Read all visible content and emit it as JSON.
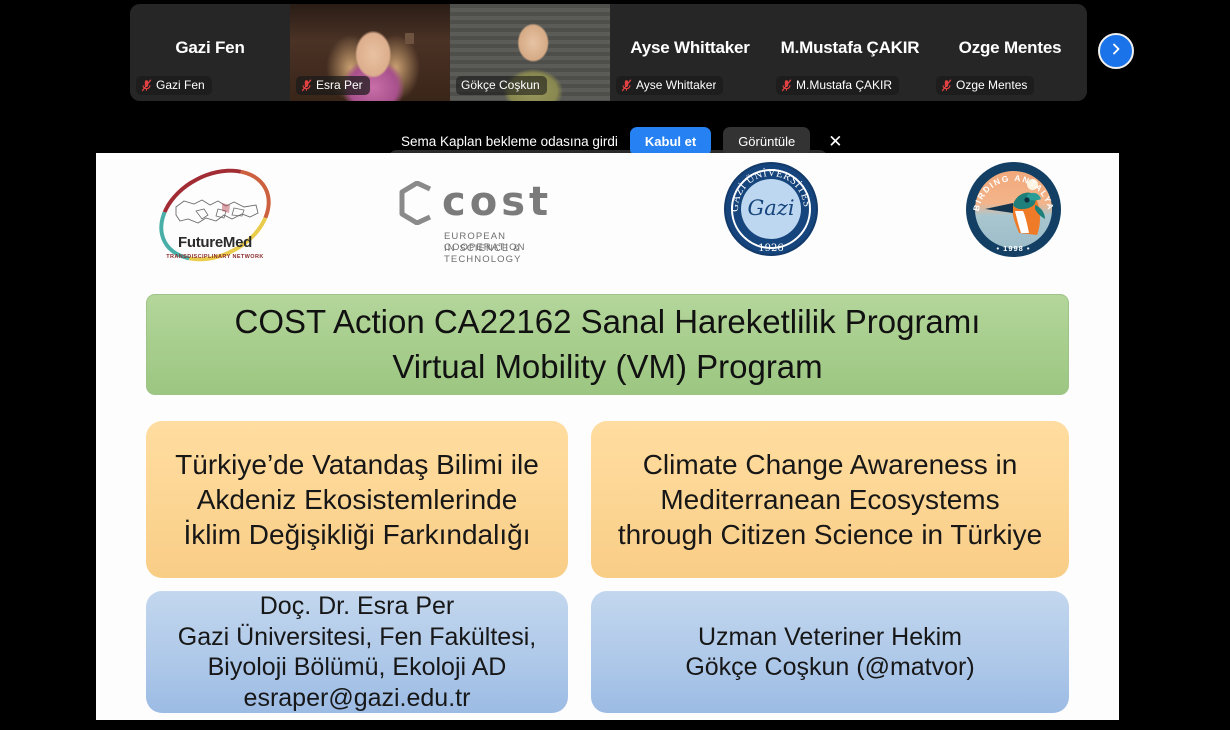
{
  "meeting": {
    "filmstrip": {
      "tiles": [
        {
          "display_name": "Gazi Fen",
          "badge_label": "Gazi Fen",
          "muted": true,
          "has_video": false,
          "active_speaker": false
        },
        {
          "display_name": "Esra Per",
          "badge_label": "Esra Per",
          "muted": true,
          "has_video": true,
          "active_speaker": false
        },
        {
          "display_name": "Gökçe Coşkun",
          "badge_label": "Gökçe Coşkun",
          "muted": false,
          "has_video": true,
          "active_speaker": true
        },
        {
          "display_name": "Ayse Whittaker",
          "badge_label": "Ayse Whittaker",
          "muted": true,
          "has_video": false,
          "active_speaker": false
        },
        {
          "display_name": "M.Mustafa ÇAKIR",
          "badge_label": "M.Mustafa ÇAKIR",
          "muted": true,
          "has_video": false,
          "active_speaker": false
        },
        {
          "display_name": "Ozge Mentes",
          "badge_label": "Ozge Mentes",
          "muted": true,
          "has_video": false,
          "active_speaker": false
        }
      ],
      "next_page_icon": "chevron-right-icon"
    },
    "notification": {
      "message": "Sema Kaplan bekleme odasına girdi",
      "accept_label": "Kabul et",
      "view_label": "Görüntüle",
      "close_icon": "close-icon",
      "accent_color": "#2681f2"
    }
  },
  "slide": {
    "logos": [
      {
        "name": "FutureMed",
        "wordmark": "FutureMed",
        "subtitle": "TRANSDISCIPLINARY NETWORK"
      },
      {
        "name": "COST",
        "wordmark": "cost",
        "subtitle_line1": "EUROPEAN  COOPERATION",
        "subtitle_line2": "IN SCIENCE & TECHNOLOGY"
      },
      {
        "name": "Gazi Üniversitesi",
        "ring_text": "GAZİ ÜNİVERSİTESİ",
        "script": "Gazi",
        "year": "1926"
      },
      {
        "name": "Birding Antalya",
        "ring_text": "BIRDING ANTALYA",
        "year": "• 1998 •"
      }
    ],
    "banner": {
      "line1": "COST Action CA22162 Sanal Hareketlilik Programı",
      "line2": "Virtual Mobility (VM) Program",
      "color": "#a9d18e"
    },
    "title_tr": {
      "line1": "Türkiye’de Vatandaş Bilimi ile",
      "line2": "Akdeniz Ekosistemlerinde",
      "line3": "İklim Değişikliği Farkındalığı",
      "color": "#fcd593"
    },
    "title_en": {
      "line1": "Climate Change Awareness in",
      "line2": "Mediterranean Ecosystems",
      "line3": "through Citizen Science in Türkiye",
      "color": "#fcd593"
    },
    "presenter_1": {
      "line1": "Doç. Dr. Esra Per",
      "line2": "Gazi Üniversitesi, Fen Fakültesi,",
      "line3": "Biyoloji Bölümü, Ekoloji AD",
      "line4": "esraper@gazi.edu.tr",
      "color": "#afc9e9"
    },
    "presenter_2": {
      "line1": "Uzman Veteriner Hekim",
      "line2": "Gökçe Coşkun (@matvor)",
      "color": "#afc9e9"
    }
  }
}
